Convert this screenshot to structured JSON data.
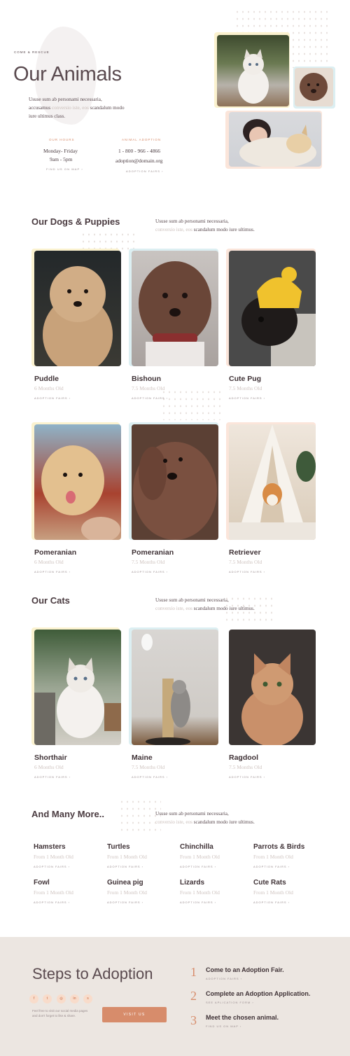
{
  "hero": {
    "eyebrow": "COME & RESCUE",
    "title": "Our Animals",
    "intro_a": "Ususe sum ab personami necessaria,",
    "intro_b": "accusamus",
    "intro_b_muted": "conversio iste, eos",
    "intro_b_tail": "scandalum modo",
    "intro_c": "iure ultimus class.",
    "hours_label": "OUR HOURS",
    "hours_days": "Monday- Friday",
    "hours_time": "9am - 5pm",
    "hours_link": "FIND US ON MAP",
    "adopt_label": "ANIMAL ADOPTION",
    "adopt_phone": "1 - 800 - 966 - 4866",
    "adopt_email": "adoption@domain.org",
    "adopt_link": "ADOPTION FAIRS"
  },
  "dogs": {
    "title": "Our Dogs & Puppies",
    "text_a": "Ususe sum ab personami necessaria,",
    "text_b_muted": "conversio iste, eos",
    "text_b_tail": "scandalum modo iure ultimus.",
    "items": [
      {
        "name": "Puddle",
        "age": "6 Months Old",
        "link": "ADOPTION FAIRS"
      },
      {
        "name": "Bishoun",
        "age": "7.5 Months Old",
        "link": "ADOPTION FAIRS"
      },
      {
        "name": "Cute Pug",
        "age": "7.5 Months Old",
        "link": "ADOPTION FAIRS"
      },
      {
        "name": "Pomeranian",
        "age": "6 Months Old",
        "link": "ADOPTION FAIRS"
      },
      {
        "name": "Pomeranian",
        "age": "7.5 Months Old",
        "link": "ADOPTION FAIRS"
      },
      {
        "name": "Retriever",
        "age": "7.5 Months Old",
        "link": "ADOPTION FAIRS"
      }
    ]
  },
  "cats": {
    "title": "Our Cats",
    "text_a": "Ususe sum ab personami necessaria,",
    "text_b_muted": "conversio iste, eos",
    "text_b_tail": "scandalum modo iure ultimus.",
    "items": [
      {
        "name": "Shorthair",
        "age": "6 Months Old",
        "link": "ADOPTION FAIRS"
      },
      {
        "name": "Maine",
        "age": "7.5 Months Old",
        "link": "ADOPTION FAIRS"
      },
      {
        "name": "Ragdool",
        "age": "7.5 Months Old",
        "link": "ADOPTION FAIRS"
      }
    ]
  },
  "more": {
    "title": "And Many More..",
    "text_a": "Ususe sum ab personami necessaria,",
    "text_b_muted": "conversio iste, eos",
    "text_b_tail": "scandalum modo iure ultimus.",
    "items": [
      {
        "name": "Hamsters",
        "age": "From 1 Month Old",
        "link": "ADOPTION FAIRS"
      },
      {
        "name": "Turtles",
        "age": "From 1 Month Old",
        "link": "ADOPTION FAIRS"
      },
      {
        "name": "Chinchilla",
        "age": "From 1 Month Old",
        "link": "ADOPTION FAIRS"
      },
      {
        "name": "Parrots & Birds",
        "age": "From 1 Month Old",
        "link": "ADOPTION FAIRS"
      },
      {
        "name": "Fowl",
        "age": "From 1 Month Old",
        "link": "ADOPTION FAIRS"
      },
      {
        "name": "Guinea pig",
        "age": "From 1 Month Old",
        "link": "ADOPTION FAIRS"
      },
      {
        "name": "Lizards",
        "age": "From 1 Month Old",
        "link": "ADOPTION FAIRS"
      },
      {
        "name": "Cute Rats",
        "age": "From 1 Month Old",
        "link": "ADOPTION FAIRS"
      }
    ]
  },
  "footer": {
    "title": "Steps to Adoption",
    "social": [
      {
        "icon": "facebook-icon",
        "glyph": "f"
      },
      {
        "icon": "twitter-icon",
        "glyph": "t"
      },
      {
        "icon": "instagram-icon",
        "glyph": "◎"
      },
      {
        "icon": "linkedin-icon",
        "glyph": "in"
      },
      {
        "icon": "skype-icon",
        "glyph": "s"
      }
    ],
    "note_a": "Feel free to visit our social media pages",
    "note_b": "and don't forget to like & share.",
    "button": "VISIT US",
    "steps": [
      {
        "num": "1",
        "title": "Come to an Adoption Fair.",
        "link": "ADOPTION FAIRS"
      },
      {
        "num": "2",
        "title": "Complete an Adoption Application.",
        "link": "SEE APLICATION FORM"
      },
      {
        "num": "3",
        "title": "Meet the chosen animal.",
        "link": "FIND US ON MAP"
      }
    ]
  },
  "colors": {
    "accent": "#d78c6b",
    "heading": "#4a3b40",
    "muted": "#c9bdb9",
    "footer_bg": "#ece6e1"
  }
}
